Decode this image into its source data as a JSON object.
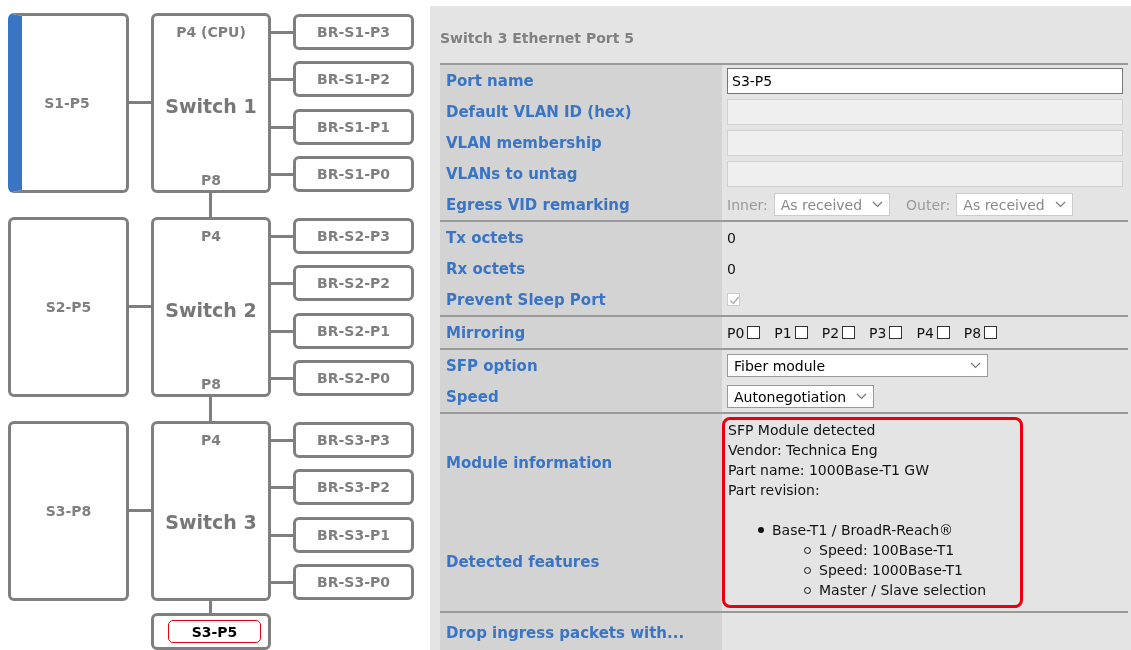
{
  "diagram": {
    "switches": [
      {
        "name": "Switch 1",
        "top_port": "P4 (CPU)",
        "bottom_port": "P8",
        "uplink": {
          "label": "S1-P5",
          "highlighted": true
        },
        "branches": [
          "BR-S1-P3",
          "BR-S1-P2",
          "BR-S1-P1",
          "BR-S1-P0"
        ]
      },
      {
        "name": "Switch 2",
        "top_port": "P4",
        "bottom_port": "P8",
        "uplink": {
          "label": "S2-P5",
          "highlighted": false
        },
        "branches": [
          "BR-S2-P3",
          "BR-S2-P2",
          "BR-S2-P1",
          "BR-S2-P0"
        ]
      },
      {
        "name": "Switch 3",
        "top_port": "P4",
        "uplink": {
          "label": "S3-P8",
          "highlighted": false
        },
        "branches": [
          "BR-S3-P3",
          "BR-S3-P2",
          "BR-S3-P1",
          "BR-S3-P0"
        ]
      }
    ],
    "endpoint": {
      "label": "S3-P5",
      "selected": true
    }
  },
  "panel": {
    "title": "Switch 3 Ethernet Port 5",
    "sections": [
      {
        "rows": [
          {
            "label": "Port name",
            "kind": "input",
            "value": "S3-P5",
            "disabled": false
          },
          {
            "label": "Default VLAN ID (hex)",
            "kind": "input",
            "disabled": true
          },
          {
            "label": "VLAN membership",
            "kind": "input",
            "disabled": true
          },
          {
            "label": "VLANs to untag",
            "kind": "input",
            "disabled": true
          },
          {
            "label": "Egress VID remarking",
            "kind": "selects",
            "selects": [
              {
                "label": "Inner:",
                "value": "As received",
                "disabled": true
              },
              {
                "label": "Outer:",
                "value": "As received",
                "disabled": true
              }
            ]
          }
        ]
      },
      {
        "rows": [
          {
            "label": "Tx octets",
            "kind": "text",
            "value": "0"
          },
          {
            "label": "Rx octets",
            "kind": "text",
            "value": "0"
          },
          {
            "label": "Prevent Sleep Port",
            "kind": "checkbox",
            "checked": true,
            "disabled": true
          }
        ]
      },
      {
        "rows": [
          {
            "label": "Mirroring",
            "kind": "checkboxes",
            "items": [
              {
                "label": "P0",
                "checked": false
              },
              {
                "label": "P1",
                "checked": false
              },
              {
                "label": "P2",
                "checked": false
              },
              {
                "label": "P3",
                "checked": false
              },
              {
                "label": "P4",
                "checked": false
              },
              {
                "label": "P8",
                "checked": false
              }
            ]
          }
        ]
      },
      {
        "rows": [
          {
            "label": "SFP option",
            "kind": "select",
            "value": "Fiber module"
          },
          {
            "label": "Speed",
            "kind": "select",
            "value": "Autonegotiation"
          }
        ]
      },
      {
        "kind": "module",
        "highlighted": true,
        "module_information": {
          "label": "Module information",
          "lines": [
            "SFP Module detected",
            "Vendor: Technica Eng",
            "Part name: 1000Base-T1 GW",
            "Part revision:"
          ]
        },
        "detected_features": {
          "label": "Detected features",
          "items": [
            {
              "text": "Base-T1 / BroadR-Reach®",
              "children": [
                {
                  "text": "Speed: 100Base-T1"
                },
                {
                  "text": "Speed: 1000Base-T1"
                },
                {
                  "text": "Master / Slave selection"
                }
              ]
            }
          ]
        }
      },
      {
        "rows": [
          {
            "label": "Drop ingress packets with...",
            "kind": "heading"
          }
        ]
      }
    ]
  }
}
